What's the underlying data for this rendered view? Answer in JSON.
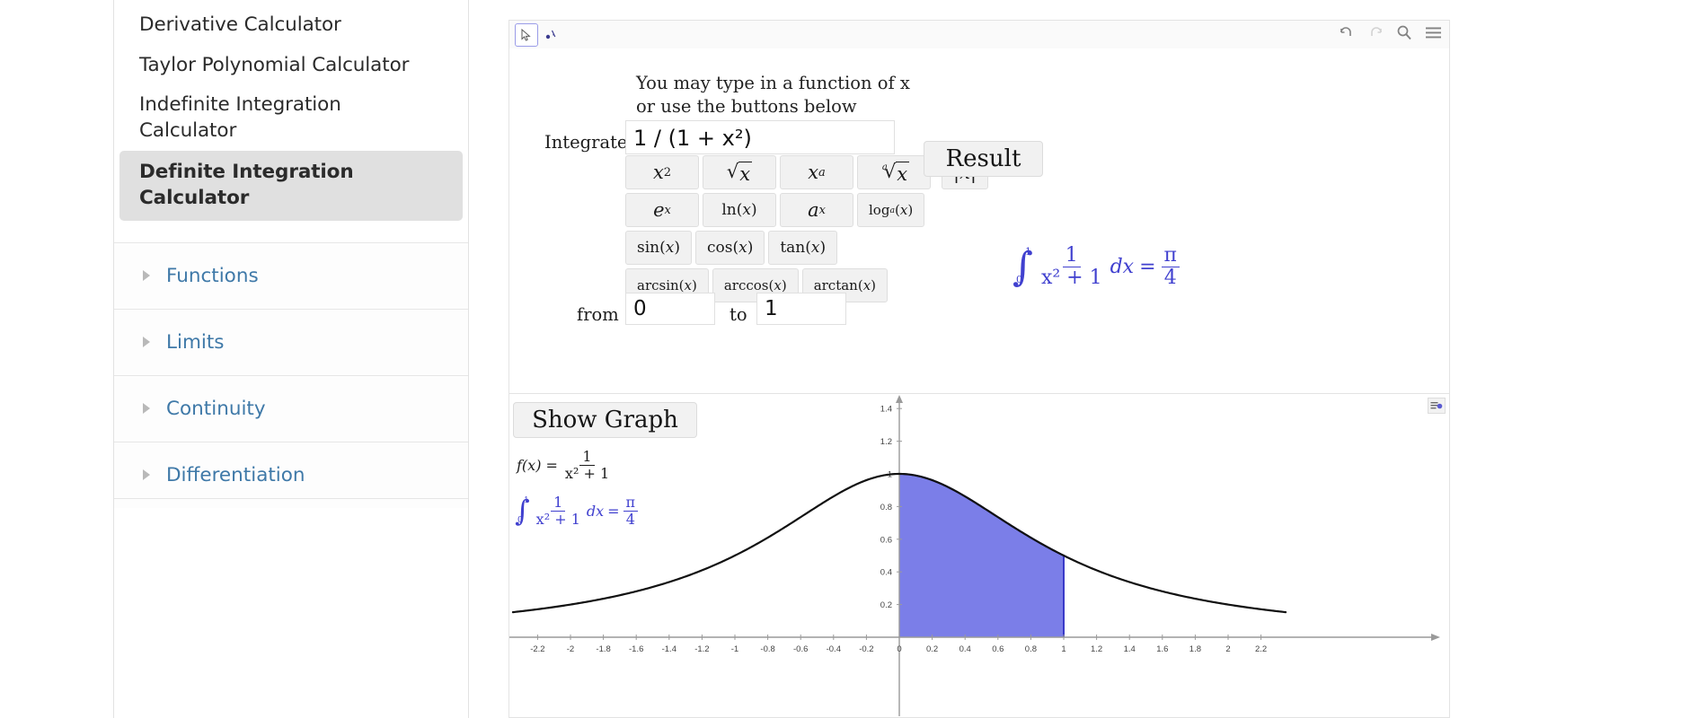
{
  "sidebar": {
    "links": [
      {
        "label": "Derivative Calculator",
        "active": false
      },
      {
        "label": "Taylor Polynomial Calculator",
        "active": false
      },
      {
        "label": "Indefinite Integration Calculator",
        "active": false
      },
      {
        "label": "Definite Integration Calculator",
        "active": true
      }
    ],
    "accordion": [
      {
        "label": "Functions"
      },
      {
        "label": "Limits"
      },
      {
        "label": "Continuity"
      },
      {
        "label": "Differentiation"
      }
    ],
    "link_color": "#3f79a8",
    "active_bg": "#e0e0e0"
  },
  "toolbar": {
    "left_tools": [
      {
        "name": "move-tool",
        "glyph": "↖",
        "selected": true
      },
      {
        "name": "point-tool",
        "glyph": "▴",
        "selected": false
      }
    ],
    "right_icons": [
      {
        "name": "undo-icon",
        "glyph": "↶"
      },
      {
        "name": "redo-icon",
        "glyph": "↷"
      },
      {
        "name": "search-icon",
        "glyph": "⌕"
      },
      {
        "name": "menu-icon",
        "glyph": "≡"
      }
    ],
    "stylebar_icons": [
      {
        "name": "drag-handle-icon",
        "glyph": "┤"
      },
      {
        "name": "grid-icon",
        "glyph": "▣"
      },
      {
        "name": "home-icon",
        "glyph": "⌂"
      },
      {
        "name": "zoom-icon",
        "glyph": "C"
      },
      {
        "name": "settings-icon",
        "glyph": "⊙"
      },
      {
        "name": "more-options-icon",
        "glyph": "⋮"
      },
      {
        "name": "style-icon",
        "glyph": "◩"
      }
    ]
  },
  "applet": {
    "hint_line1": "You may type in a function of x",
    "hint_line2": "or use the buttons below",
    "integrate_label": "Integrate",
    "function_value": "1 / (1 + x²)",
    "function_placeholder": "",
    "from_label": "from",
    "from_value": "0",
    "to_label": "to",
    "to_value": "1",
    "result_label": "Result",
    "show_graph_label": "Show Graph",
    "function_buttons": [
      [
        {
          "name": "x-squared-button",
          "kind": "sup",
          "base": "x",
          "exp": "2"
        },
        {
          "name": "sqrt-x-button",
          "kind": "sqrt",
          "index": "",
          "radicand": "x"
        },
        {
          "name": "x-to-a-button",
          "kind": "sup",
          "base": "x",
          "exp": "a"
        },
        {
          "name": "nth-root-x-button",
          "kind": "sqrt",
          "index": "a",
          "radicand": "x"
        },
        {
          "name": "abs-x-button",
          "kind": "plain",
          "text": "|x|"
        }
      ],
      [
        {
          "name": "e-to-x-button",
          "kind": "sup",
          "base": "e",
          "exp": "x"
        },
        {
          "name": "ln-x-button",
          "kind": "plain",
          "text": "ln(x)"
        },
        {
          "name": "a-to-x-button",
          "kind": "sup",
          "base": "a",
          "exp": "x"
        },
        {
          "name": "log-base-a-button",
          "kind": "sub",
          "base": "log",
          "sub": "a",
          "tail": "(x)"
        }
      ],
      [
        {
          "name": "sin-button",
          "kind": "plain",
          "text": "sin(x)"
        },
        {
          "name": "cos-button",
          "kind": "plain",
          "text": "cos(x)"
        },
        {
          "name": "tan-button",
          "kind": "plain",
          "text": "tan(x)"
        }
      ],
      [
        {
          "name": "arcsin-button",
          "kind": "plain",
          "text": "arcsin(x)"
        },
        {
          "name": "arccos-button",
          "kind": "plain",
          "text": "arccos(x)"
        },
        {
          "name": "arctan-button",
          "kind": "plain",
          "text": "arctan(x)"
        }
      ]
    ],
    "result_expression": {
      "integral_lower": "0",
      "integral_upper": "1",
      "numerator": "1",
      "denominator": "x² + 1",
      "differential": "dx",
      "equals": "=",
      "value_num": "π",
      "value_den": "4",
      "color": "#4040cf"
    },
    "function_definition": {
      "lhs": "f(x) =",
      "numerator": "1",
      "denominator": "x² + 1"
    }
  },
  "chart_data": {
    "type": "area",
    "title": "",
    "xlabel": "",
    "ylabel": "",
    "function": "f(x) = 1/(x^2 + 1)",
    "xlim": [
      -2.35,
      2.35
    ],
    "ylim": [
      -0.08,
      1.52
    ],
    "grid": false,
    "curve_color": "#111111",
    "fill_color": "#7b7ee8",
    "fill_outline_color": "#3a3ac8",
    "shaded_interval": [
      0,
      1
    ],
    "shaded_area_value": "π/4",
    "xticks": [
      -2.2,
      -2,
      -1.8,
      -1.6,
      -1.4,
      -1.2,
      -1,
      -0.8,
      -0.6,
      -0.4,
      -0.2,
      0,
      0.2,
      0.4,
      0.6,
      0.8,
      1,
      1.2,
      1.4,
      1.6,
      1.8,
      2,
      2.2
    ],
    "xticklabels": [
      "-2.2",
      "-2",
      "-1.8",
      "-1.6",
      "-1.4",
      "-1.2",
      "-1",
      "-0.8",
      "-0.6",
      "-0.4",
      "-0.2",
      "0",
      "0.2",
      "0.4",
      "0.6",
      "0.8",
      "1",
      "1.2",
      "1.4",
      "1.6",
      "1.8",
      "2",
      "2.2"
    ],
    "yticks": [
      0.2,
      0.4,
      0.6,
      0.8,
      1,
      1.2,
      1.4
    ],
    "yticklabels": [
      "0.2",
      "0.4",
      "0.6",
      "0.8",
      "1",
      "1.2",
      "1.4"
    ],
    "points": [
      {
        "x": -2.4,
        "y": 0.1479
      },
      {
        "x": -2.2,
        "y": 0.1712
      },
      {
        "x": -2.0,
        "y": 0.2
      },
      {
        "x": -1.8,
        "y": 0.2358
      },
      {
        "x": -1.6,
        "y": 0.2809
      },
      {
        "x": -1.4,
        "y": 0.3378
      },
      {
        "x": -1.2,
        "y": 0.4098
      },
      {
        "x": -1.0,
        "y": 0.5
      },
      {
        "x": -0.8,
        "y": 0.6098
      },
      {
        "x": -0.6,
        "y": 0.7353
      },
      {
        "x": -0.4,
        "y": 0.8621
      },
      {
        "x": -0.2,
        "y": 0.9615
      },
      {
        "x": 0.0,
        "y": 1.0
      },
      {
        "x": 0.2,
        "y": 0.9615
      },
      {
        "x": 0.4,
        "y": 0.8621
      },
      {
        "x": 0.6,
        "y": 0.7353
      },
      {
        "x": 0.8,
        "y": 0.6098
      },
      {
        "x": 1.0,
        "y": 0.5
      },
      {
        "x": 1.2,
        "y": 0.4098
      },
      {
        "x": 1.4,
        "y": 0.3378
      },
      {
        "x": 1.6,
        "y": 0.2809
      },
      {
        "x": 1.8,
        "y": 0.2358
      },
      {
        "x": 2.0,
        "y": 0.2
      },
      {
        "x": 2.2,
        "y": 0.1712
      },
      {
        "x": 2.4,
        "y": 0.1479
      }
    ]
  }
}
